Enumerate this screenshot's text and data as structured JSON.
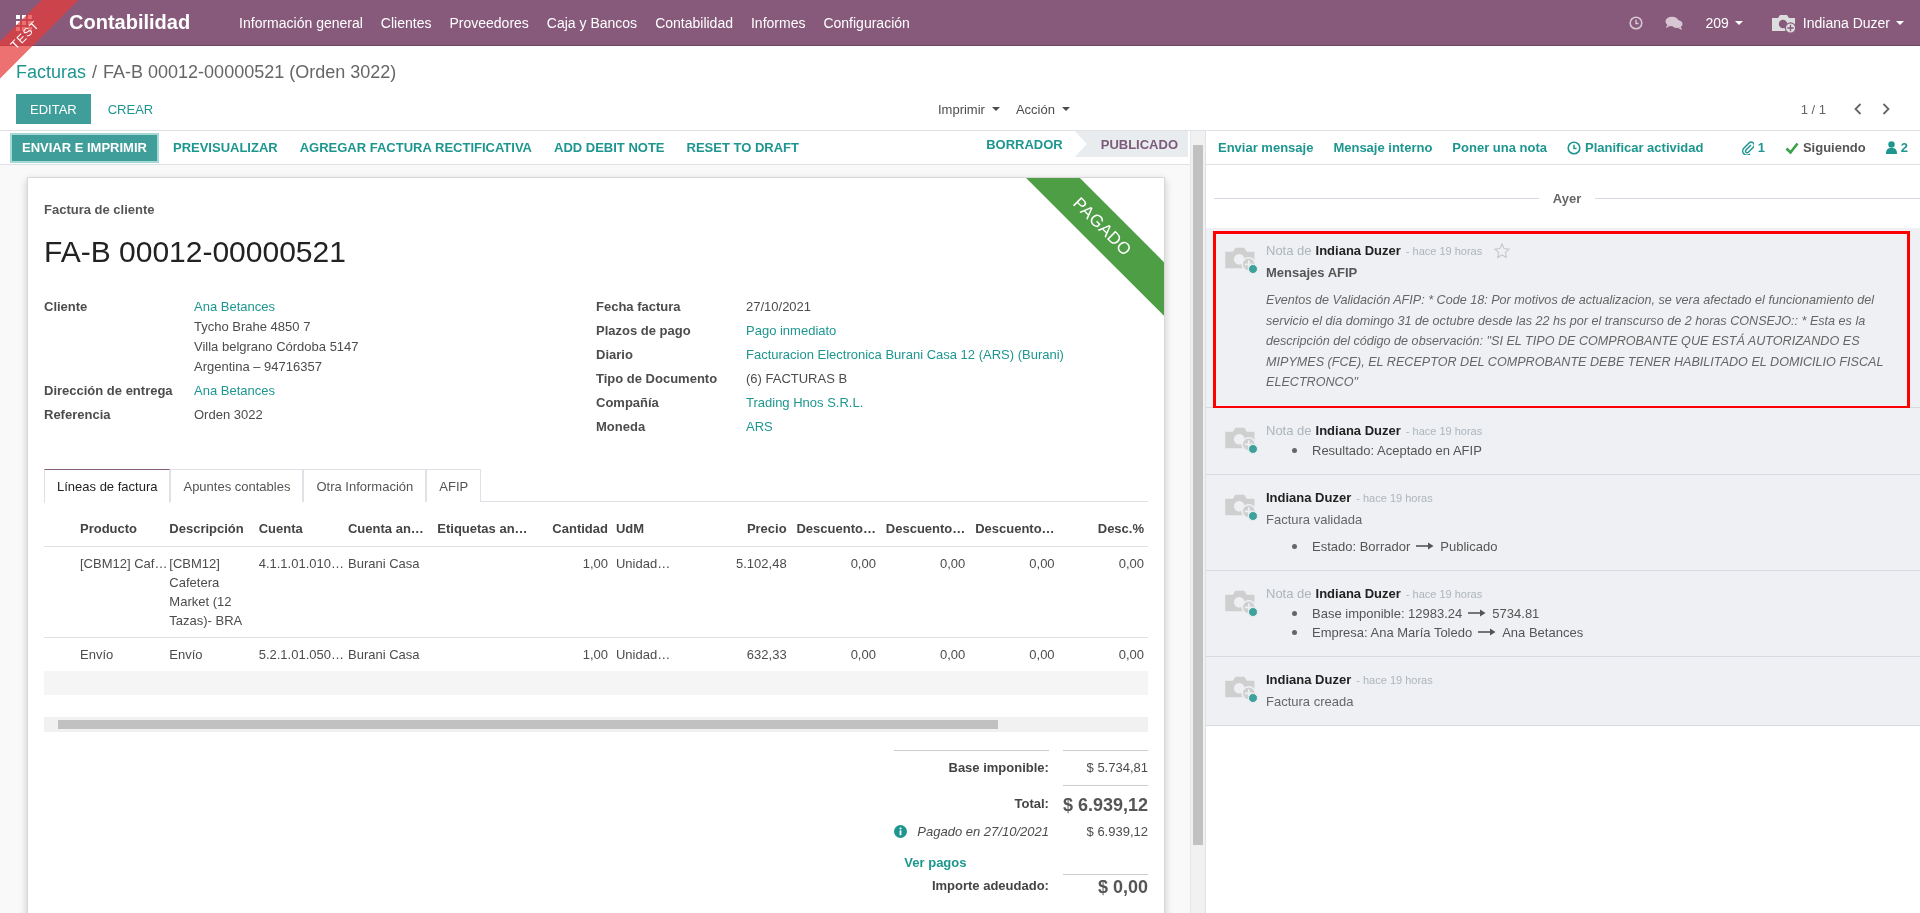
{
  "environment_ribbon": {
    "label": "TEST"
  },
  "navbar": {
    "app_name": "Contabilidad",
    "menu": [
      "Información general",
      "Clientes",
      "Proveedores",
      "Caja y Bancos",
      "Contabilidad",
      "Informes",
      "Configuración"
    ],
    "counter": "209",
    "user": "Indiana Duzer"
  },
  "breadcrumb_separator": "/",
  "breadcrumb": [
    {
      "label": "Facturas",
      "kind": "link"
    },
    {
      "label": "FA-B 00012-00000521 (Orden 3022)",
      "kind": "current"
    }
  ],
  "control_buttons": [
    {
      "label": "EDITAR",
      "kind": "primary"
    },
    {
      "label": "CREAR",
      "kind": "link"
    }
  ],
  "dropdowns": [
    "Imprimir",
    "Acción"
  ],
  "pager": "1 / 1",
  "form_buttons": [
    {
      "label": "ENVIAR E IMPRIMIR",
      "kind": "primary"
    },
    {
      "label": "PREVISUALIZAR",
      "kind": "link"
    },
    {
      "label": "AGREGAR FACTURA RECTIFICATIVA",
      "kind": "link"
    },
    {
      "label": "ADD DEBIT NOTE",
      "kind": "link"
    },
    {
      "label": "RESET TO DRAFT",
      "kind": "link"
    }
  ],
  "status_steps": [
    {
      "label": "BORRADOR",
      "selected": false
    },
    {
      "label": "PUBLICADO",
      "selected": true
    }
  ],
  "invoice": {
    "type_label": "Factura de cliente",
    "number": "FA-B 00012-00000521",
    "ribbon": "PAGADO",
    "left_fields": [
      {
        "label": "Cliente",
        "value": "Ana Betances",
        "kind": "link",
        "address": [
          "Tycho Brahe 4850 7",
          "Villa belgrano Córdoba 5147",
          "Argentina – 94716357"
        ]
      },
      {
        "label": "Dirección de entrega",
        "value": "Ana Betances",
        "kind": "link"
      },
      {
        "label": "Referencia",
        "value": "Orden 3022",
        "kind": "text"
      }
    ],
    "right_fields": [
      {
        "label": "Fecha factura",
        "value": "27/10/2021",
        "kind": "text"
      },
      {
        "label": "Plazos de pago",
        "value": "Pago inmediato",
        "kind": "link"
      },
      {
        "label": "Diario",
        "value": "Facturacion Electronica Burani Casa 12 (ARS) (Burani)",
        "kind": "link"
      },
      {
        "label": "Tipo de Documento",
        "value": "(6) FACTURAS B",
        "kind": "text"
      },
      {
        "label": "Compañía",
        "value": "Trading Hnos S.R.L.",
        "kind": "link"
      },
      {
        "label": "Moneda",
        "value": "ARS",
        "kind": "link"
      }
    ]
  },
  "tabs": [
    {
      "label": "Líneas de factura",
      "selected": true
    },
    {
      "label": "Apuntes contables",
      "selected": false
    },
    {
      "label": "Otra Información",
      "selected": false
    },
    {
      "label": "AFIP",
      "selected": false
    }
  ],
  "invoice_lines": {
    "columns": [
      {
        "label": "Producto",
        "kind": "text"
      },
      {
        "label": "Descripción",
        "kind": "text"
      },
      {
        "label": "Cuenta",
        "kind": "text"
      },
      {
        "label": "Cuenta an…",
        "kind": "text"
      },
      {
        "label": "Etiquetas an…",
        "kind": "text"
      },
      {
        "label": "Cantidad",
        "kind": "number"
      },
      {
        "label": "UdM",
        "kind": "text"
      },
      {
        "label": "Precio",
        "kind": "number"
      },
      {
        "label": "Descuento…",
        "kind": "number"
      },
      {
        "label": "Descuento…",
        "kind": "number"
      },
      {
        "label": "Descuento…",
        "kind": "number"
      },
      {
        "label": "Desc.%",
        "kind": "number"
      }
    ],
    "rows": [
      {
        "cells": [
          "[CBM12] Caf…",
          "[CBM12] Cafetera Market (12 Tazas)- BRA",
          "4.1.1.01.010…",
          "Burani Casa",
          null,
          "1,00",
          "Unidad…",
          "5.102,48",
          "0,00",
          "0,00",
          "0,00",
          "0,00"
        ]
      },
      {
        "cells": [
          "Envío",
          "Envío",
          "5.2.1.01.050…",
          "Burani Casa",
          null,
          "1,00",
          "Unidad…",
          "632,33",
          "0,00",
          "0,00",
          "0,00",
          "0,00"
        ]
      }
    ]
  },
  "totals": [
    {
      "label": "Base imponible:",
      "value": "$ 5.734,81",
      "kind": "subtotal"
    },
    {
      "label": "Total:",
      "value": "$ 6.939,12",
      "kind": "total"
    },
    {
      "label": "Pagado en 27/10/2021",
      "value": "$ 6.939,12",
      "kind": "payment"
    },
    {
      "label": "Ver pagos",
      "kind": "link"
    },
    {
      "label": "Importe adeudado:",
      "value": "$ 0,00",
      "kind": "due"
    }
  ],
  "chatter": {
    "actions": [
      "Enviar mensaje",
      "Mensaje interno",
      "Poner una nota"
    ],
    "schedule_activity": "Planificar actividad",
    "attachments": "1",
    "follow_label": "Siguiendo",
    "followers": "2",
    "date_separator": "Ayer",
    "messages": [
      {
        "kind": "note",
        "prefix": "Nota de",
        "author": "Indiana Duzer",
        "time": "- hace 19 horas",
        "starred": false,
        "highlighted": true,
        "subject": "Mensajes AFIP",
        "body": {
          "kind": "italic",
          "text": "Eventos de Validación AFIP: * Code 18: Por motivos de actualizacion, se vera afectado el funcionamiento del servicio el dia domingo 31 de octubre desde las 22 hs por el transcurso de 2 horas CONSEJO:: * Esta es la descripción del código de observación: \"SI EL TIPO DE COMPROBANTE QUE ESTÁ AUTORIZANDO ES MIPYMES (FCE), EL RECEPTOR DEL COMPROBANTE DEBE TENER HABILITADO EL DOMICILIO FISCAL ELECTRONCO\""
        }
      },
      {
        "kind": "note",
        "prefix": "Nota de",
        "author": "Indiana Duzer",
        "time": "- hace 19 horas",
        "highlighted": false,
        "changes": [
          {
            "label": "Resultado: Aceptado en AFIP"
          }
        ]
      },
      {
        "kind": "message",
        "author": "Indiana Duzer",
        "time": "- hace 19 horas",
        "highlighted": false,
        "body": {
          "kind": "plain",
          "text": "Factura validada"
        },
        "changes": [
          {
            "label": "Estado: Borrador",
            "new": "Publicado"
          }
        ]
      },
      {
        "kind": "note",
        "prefix": "Nota de",
        "author": "Indiana Duzer",
        "time": "- hace 19 horas",
        "highlighted": false,
        "changes": [
          {
            "label": "Base imponible: 12983.24",
            "new": "5734.81"
          },
          {
            "label": "Empresa: Ana María Toledo",
            "new": "Ana Betances"
          }
        ]
      },
      {
        "kind": "message",
        "author": "Indiana Duzer",
        "time": "- hace 19 horas",
        "highlighted": false,
        "body": {
          "kind": "plain",
          "text": "Factura creada"
        }
      }
    ]
  }
}
